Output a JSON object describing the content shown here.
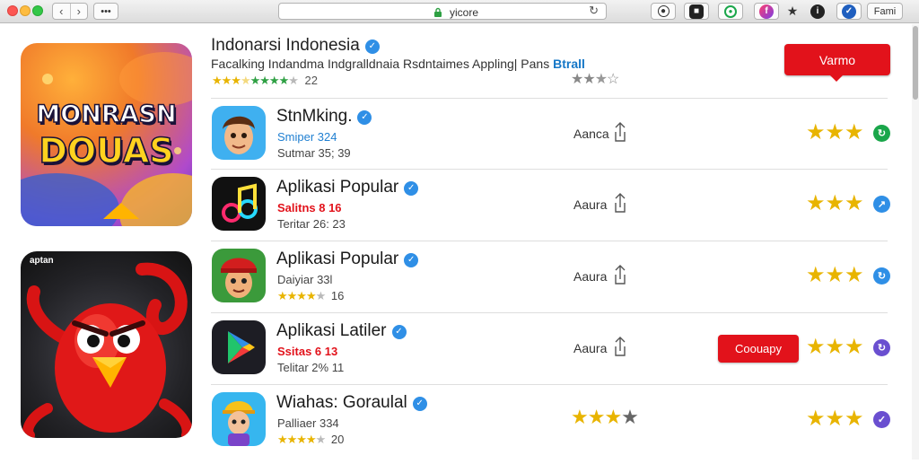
{
  "browser": {
    "url": "yicore",
    "profile_label": "Fami",
    "menu_label": "•••"
  },
  "banners": [
    {
      "line1": "MONRASN",
      "line2": "DOUAS"
    },
    {
      "caption": "aptan"
    }
  ],
  "hero": {
    "title": "Indonarsi Indonesia",
    "subtitle": "Facalking Indandma Indgralldnaia Rsdntaimes Appling| Pans",
    "subtitle_highlight": "Btrall",
    "rating_count": "22",
    "button_label": "Varmo"
  },
  "apps": [
    {
      "name": "StnMking.",
      "line1": "Smiper 324",
      "line2": "Sutmar 35; 39",
      "install_label": "Aanca",
      "badge_color": "#1aa64a",
      "badge_glyph": "↻"
    },
    {
      "name": "Aplikasi Popular",
      "line1": "Salitns 8 16",
      "line2": "Teritar 26: 23",
      "install_label": "Aaura",
      "badge_color": "#2f8fe6",
      "badge_glyph": "↗"
    },
    {
      "name": "Aplikasi Popular",
      "line1": "Daiyiar 33l",
      "rating_count": "16",
      "install_label": "Aaura",
      "badge_color": "#2f8fe6",
      "badge_glyph": "↻"
    },
    {
      "name": "Aplikasi Latiler",
      "line1": "Ssitas 6 13",
      "line2": "Telitar 2% 11",
      "install_label": "Aaura",
      "button_label": "Coouapy",
      "badge_color": "#6a4fd0",
      "badge_glyph": "↻"
    },
    {
      "name": "Wiahas: Goraulal",
      "line1": "Palliaer 334",
      "rating_count": "20",
      "badge_color": "#6a4fd0",
      "badge_glyph": "✓"
    }
  ]
}
